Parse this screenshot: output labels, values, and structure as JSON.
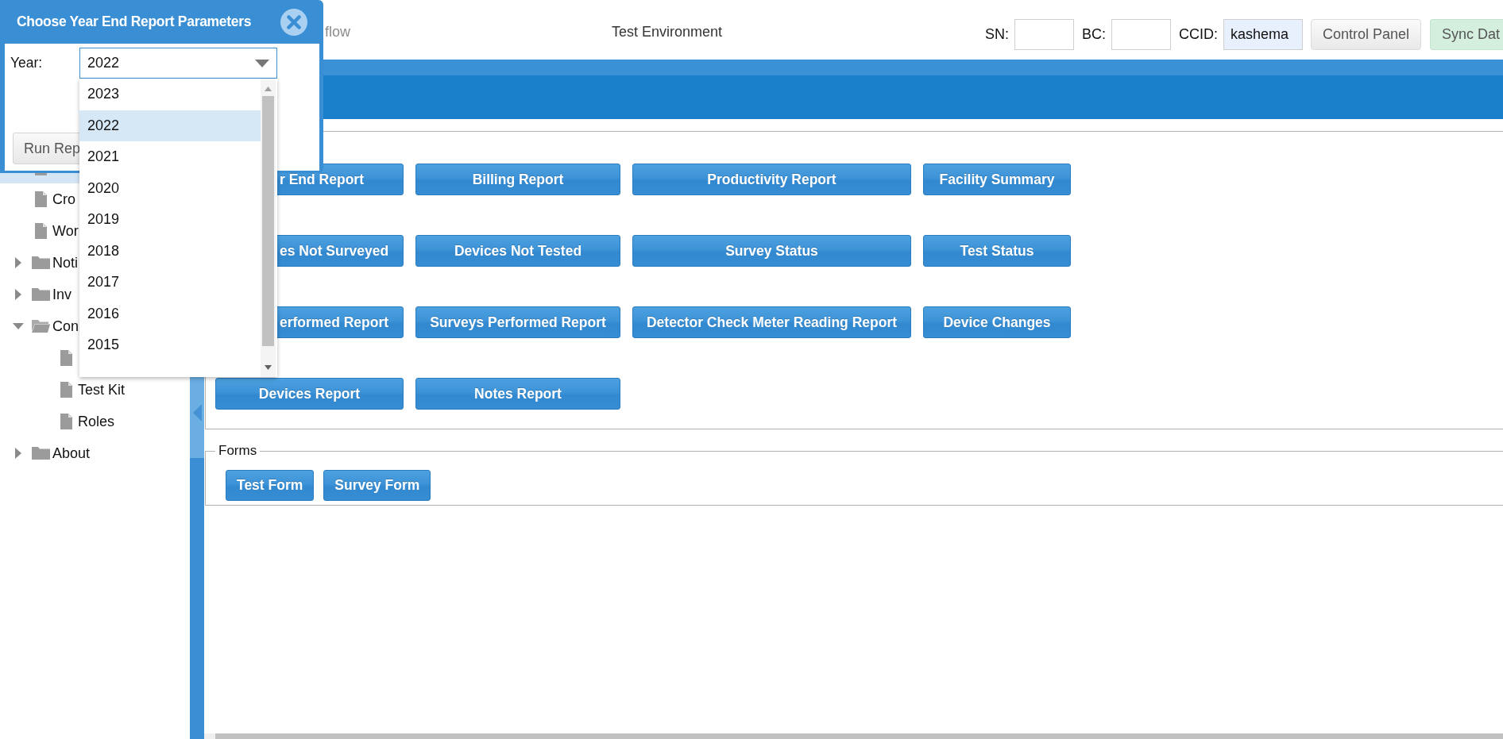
{
  "header": {
    "app_title": "flow",
    "environment": "Test Environment",
    "fields": [
      {
        "label": "SN:",
        "autofilled": false
      },
      {
        "label": "BC:",
        "autofilled": false
      },
      {
        "label": "CCID:",
        "value": "kashema",
        "autofilled": true
      }
    ],
    "buttons": [
      {
        "label": "Control Panel",
        "kind": "default"
      },
      {
        "label": "Sync Dat",
        "kind": "success"
      }
    ]
  },
  "sidebar": {
    "tree": [
      {
        "kind": "file",
        "selected": true
      },
      {
        "kind": "file",
        "label": "Cro",
        "selected": false
      },
      {
        "kind": "file",
        "label": "Wor",
        "selected": false
      },
      {
        "kind": "folder",
        "label": "Noti",
        "expanded": false,
        "selected": false
      },
      {
        "kind": "folder",
        "label": "Inv",
        "expanded": false,
        "selected": false
      },
      {
        "kind": "folder",
        "label": "Con",
        "expanded": true,
        "selected": false,
        "children": [
          {
            "kind": "file",
            "selected": false
          },
          {
            "kind": "file",
            "label": "Test Kit",
            "selected": false
          },
          {
            "kind": "file",
            "label": "Roles",
            "selected": false
          }
        ]
      },
      {
        "kind": "folder",
        "label": "About",
        "expanded": false,
        "selected": false
      }
    ]
  },
  "reports": {
    "rows": [
      [
        "r End Report",
        "Billing Report",
        "Productivity Report",
        "Facility Summary"
      ],
      [
        "es Not Surveyed",
        "Devices Not Tested",
        "Survey Status",
        "Test Status"
      ],
      [
        "erformed Report",
        "Surveys Performed Report",
        "Detector Check Meter Reading Report",
        "Device Changes"
      ],
      [
        "Devices Report",
        "Notes Report"
      ]
    ]
  },
  "forms": {
    "legend": "Forms",
    "buttons": [
      "Test Form",
      "Survey Form"
    ]
  },
  "dialog": {
    "title": "Choose Year End Report Parameters",
    "year_label": "Year:",
    "year_select": {
      "value": "2022",
      "open": true,
      "options": [
        {
          "label": "2023",
          "selected": false
        },
        {
          "label": "2022",
          "selected": true
        },
        {
          "label": "2021",
          "selected": false
        },
        {
          "label": "2020",
          "selected": false
        },
        {
          "label": "2019",
          "selected": false
        },
        {
          "label": "2018",
          "selected": false
        },
        {
          "label": "2017",
          "selected": false
        },
        {
          "label": "2016",
          "selected": false
        },
        {
          "label": "2015",
          "selected": false
        }
      ]
    },
    "run_button": {
      "label": "Run Rep"
    }
  }
}
